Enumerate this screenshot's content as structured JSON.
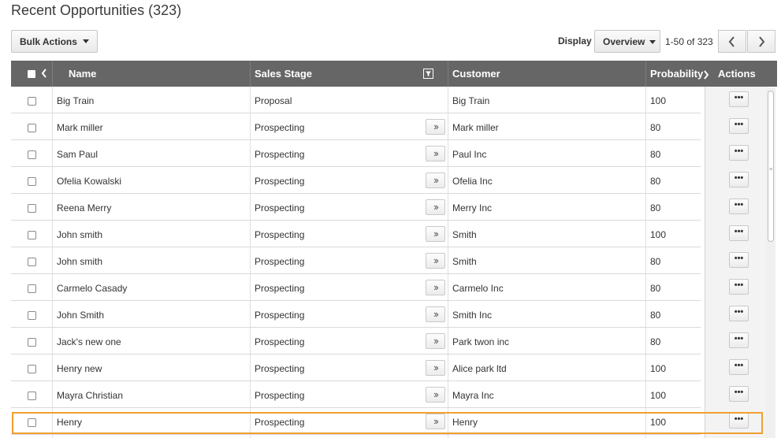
{
  "page": {
    "title": "Recent Opportunities (323)"
  },
  "toolbar": {
    "bulk_actions_label": "Bulk Actions",
    "display_label": "Display",
    "display_value": "Overview",
    "range_text": "1-50 of 323"
  },
  "table": {
    "headers": {
      "name": "Name",
      "sales_stage": "Sales Stage",
      "customer": "Customer",
      "probability": "Probability",
      "actions": "Actions"
    },
    "rows": [
      {
        "name": "Big Train",
        "stage": "Proposal",
        "customer": "Big Train",
        "probability": "100",
        "has_advance": false
      },
      {
        "name": "Mark miller",
        "stage": "Prospecting",
        "customer": "Mark miller",
        "probability": "80",
        "has_advance": true
      },
      {
        "name": "Sam Paul",
        "stage": "Prospecting",
        "customer": "Paul Inc",
        "probability": "80",
        "has_advance": true
      },
      {
        "name": "Ofelia Kowalski",
        "stage": "Prospecting",
        "customer": "Ofelia Inc",
        "probability": "80",
        "has_advance": true
      },
      {
        "name": "Reena Merry",
        "stage": "Prospecting",
        "customer": "Merry Inc",
        "probability": "80",
        "has_advance": true
      },
      {
        "name": "John smith",
        "stage": "Prospecting",
        "customer": "Smith",
        "probability": "100",
        "has_advance": true
      },
      {
        "name": "John smith",
        "stage": "Prospecting",
        "customer": "Smith",
        "probability": "80",
        "has_advance": true
      },
      {
        "name": "Carmelo Casady",
        "stage": "Prospecting",
        "customer": "Carmelo Inc",
        "probability": "80",
        "has_advance": true
      },
      {
        "name": "John Smith",
        "stage": "Prospecting",
        "customer": "Smith Inc",
        "probability": "80",
        "has_advance": true
      },
      {
        "name": "Jack's new one",
        "stage": "Prospecting",
        "customer": "Park twon inc",
        "probability": "80",
        "has_advance": true
      },
      {
        "name": "Henry new",
        "stage": "Prospecting",
        "customer": "Alice park ltd",
        "probability": "100",
        "has_advance": true
      },
      {
        "name": "Mayra Christian",
        "stage": "Prospecting",
        "customer": "Mayra Inc",
        "probability": "100",
        "has_advance": true
      },
      {
        "name": "Henry",
        "stage": "Prospecting",
        "customer": "Henry",
        "probability": "100",
        "has_advance": true,
        "highlighted": true
      }
    ],
    "advance_glyph": "››",
    "actions_glyph": "•••"
  },
  "colors": {
    "header_bg": "#666666",
    "highlight": "#f0a030",
    "actions_bg": "#f3f3f3"
  },
  "icons": {
    "bulk_caret": "caret-down-icon",
    "display_caret": "caret-down-icon",
    "pager_prev": "chevron-left-icon",
    "pager_next": "chevron-right-icon",
    "filter": "filter-icon"
  }
}
